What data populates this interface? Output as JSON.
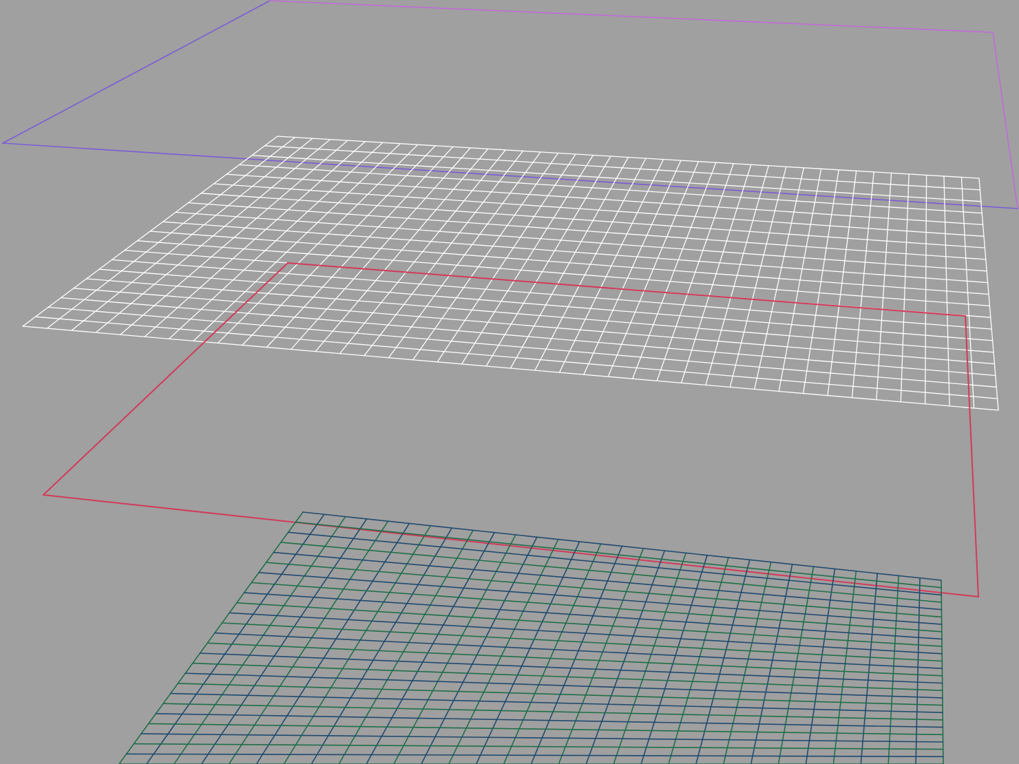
{
  "viewport": {
    "background": "#a0a0a0"
  },
  "planes": [
    {
      "name": "top-plane-outline",
      "kind": "outline",
      "colors": [
        "#7a5cd6",
        "#c06ad8"
      ],
      "subdivisions": [
        1,
        1
      ]
    },
    {
      "name": "white-grid-plane",
      "kind": "grid",
      "colors": [
        "#ffffff"
      ],
      "subdivisions": [
        40,
        20
      ]
    },
    {
      "name": "red-plane-outline",
      "kind": "outline",
      "colors": [
        "#d23a5a"
      ],
      "subdivisions": [
        1,
        1
      ]
    },
    {
      "name": "green-grid-plane",
      "kind": "grid",
      "colors": [
        "#1f6e4a",
        "#1f4a6e"
      ],
      "subdivisions": [
        30,
        25
      ]
    }
  ]
}
